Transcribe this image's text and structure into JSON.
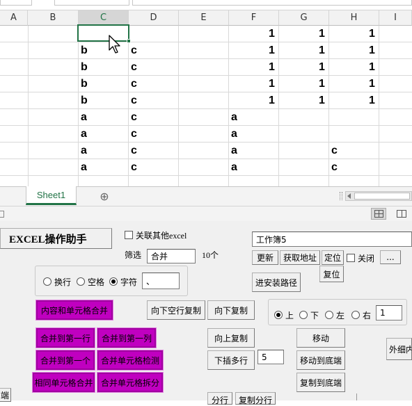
{
  "spreadsheet": {
    "columns": [
      "A",
      "B",
      "C",
      "D",
      "E",
      "F",
      "G",
      "H",
      "I"
    ],
    "cells": {
      "f1": "1",
      "g1": "1",
      "h1": "1",
      "c2": "b",
      "d2": "c",
      "f2": "1",
      "g2": "1",
      "h2": "1",
      "c3": "b",
      "d3": "c",
      "f3": "1",
      "g3": "1",
      "h3": "1",
      "c4": "b",
      "d4": "c",
      "f4": "1",
      "g4": "1",
      "h4": "1",
      "c5": "b",
      "d5": "c",
      "f5": "1",
      "g5": "1",
      "h5": "1",
      "c6": "a",
      "d6": "c",
      "f6": "a",
      "c7": "a",
      "d7": "c",
      "f7": "a",
      "c8": "a",
      "d8": "c",
      "f8": "a",
      "h8": "c",
      "c9": "a",
      "d9": "c",
      "f9": "a",
      "h9": "c"
    },
    "sheet_tab": "Sheet1",
    "add_sheet": "⊕"
  },
  "tool": {
    "title": "EXCEL操作助手",
    "link_other_label": "关联其他excel",
    "filter_label": "筛选",
    "filter_value": "合并",
    "count_label": "10个",
    "workbook_value": "工作簿5",
    "refresh": "更新",
    "get_address": "获取地址",
    "locate": "定位",
    "close_label": "关闭",
    "more": "...",
    "install_path": "进安装路径",
    "reset": "复位",
    "sep_options": [
      "换行",
      "空格",
      "字符"
    ],
    "sep_value": "、",
    "merge_content": "内容和单元格合并",
    "copy_down_blank": "向下空行复制",
    "copy_down": "向下复制",
    "dir_up": "上",
    "dir_down": "下",
    "dir_left": "左",
    "dir_right": "右",
    "dir_value": "1",
    "merge_first_row": "合并到第一行",
    "merge_first_col": "合并到第一列",
    "copy_up": "向上复制",
    "move": "移动",
    "merge_first_one": "合并到第一个",
    "merge_cell_check": "合并单元格检测",
    "insert_rows": "下插多行",
    "insert_value": "5",
    "move_bottom": "移动到底端",
    "outer_detail": "外细内",
    "merge_same": "相同单元格合并",
    "merge_split": "合并单元格拆分",
    "copy_bottom": "复制到底端",
    "split_rows": "分行",
    "copy_split_rows": "复制分行",
    "end_label": "端"
  }
}
